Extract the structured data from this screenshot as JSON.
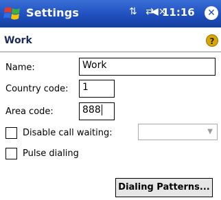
{
  "titlebar": {
    "app_title": "Settings",
    "time": "11:16",
    "icons": [
      "start-icon",
      "signal-icon",
      "connectivity-icon",
      "volume-icon",
      "close-icon"
    ]
  },
  "header": {
    "title": "Work",
    "help_symbol": "?"
  },
  "form": {
    "name_label": "Name:",
    "name_value": "Work",
    "country_code_label": "Country code:",
    "country_code_value": "1",
    "area_code_label": "Area code:",
    "area_code_value": "888",
    "disable_call_waiting_label": "Disable call waiting:",
    "disable_call_waiting_checked": false,
    "disable_call_waiting_value": "",
    "pulse_dialing_label": "Pulse dialing",
    "pulse_dialing_checked": false
  },
  "buttons": {
    "dialing_patterns": "Dialing Patterns..."
  },
  "colors": {
    "titlebar": "#1f4fbf",
    "header_text": "#1a2a5e",
    "help_icon": "#d9a500"
  }
}
